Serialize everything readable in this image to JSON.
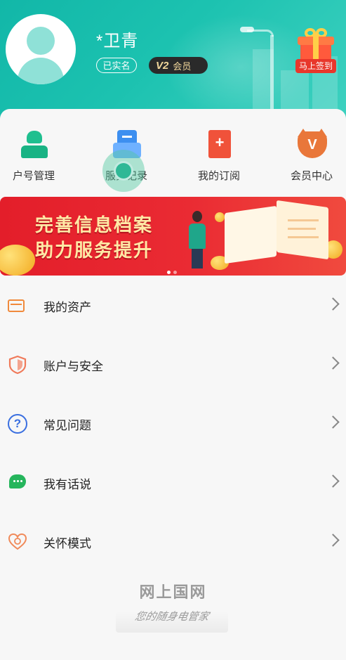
{
  "profile": {
    "username": "*卫青",
    "verified_badge": "已实名",
    "vip_level": "V2",
    "vip_label": "会员",
    "signin_button": "马上签到"
  },
  "quick_actions": [
    {
      "label": "户号管理",
      "icon": "account-user-icon"
    },
    {
      "label": "服务记录",
      "icon": "service-record-icon"
    },
    {
      "label": "我的订阅",
      "icon": "subscription-icon"
    },
    {
      "label": "会员中心",
      "icon": "member-center-icon"
    }
  ],
  "banner": {
    "line1": "完善信息档案",
    "line2": "助力服务提升",
    "page_count": 2,
    "active_page": 1
  },
  "menu": [
    {
      "label": "我的资产",
      "icon": "wallet-icon"
    },
    {
      "label": "账户与安全",
      "icon": "shield-icon"
    },
    {
      "label": "常见问题",
      "icon": "question-icon"
    },
    {
      "label": "我有话说",
      "icon": "chat-icon"
    },
    {
      "label": "关怀模式",
      "icon": "care-heart-icon"
    }
  ],
  "footer": {
    "brand": "网上国网",
    "slogan": "您的随身电管家"
  },
  "colors": {
    "header_teal": "#1cc2b0",
    "banner_red": "#e31e2a",
    "signin_red": "#e8372b",
    "vip_gold": "#f1d79b"
  }
}
